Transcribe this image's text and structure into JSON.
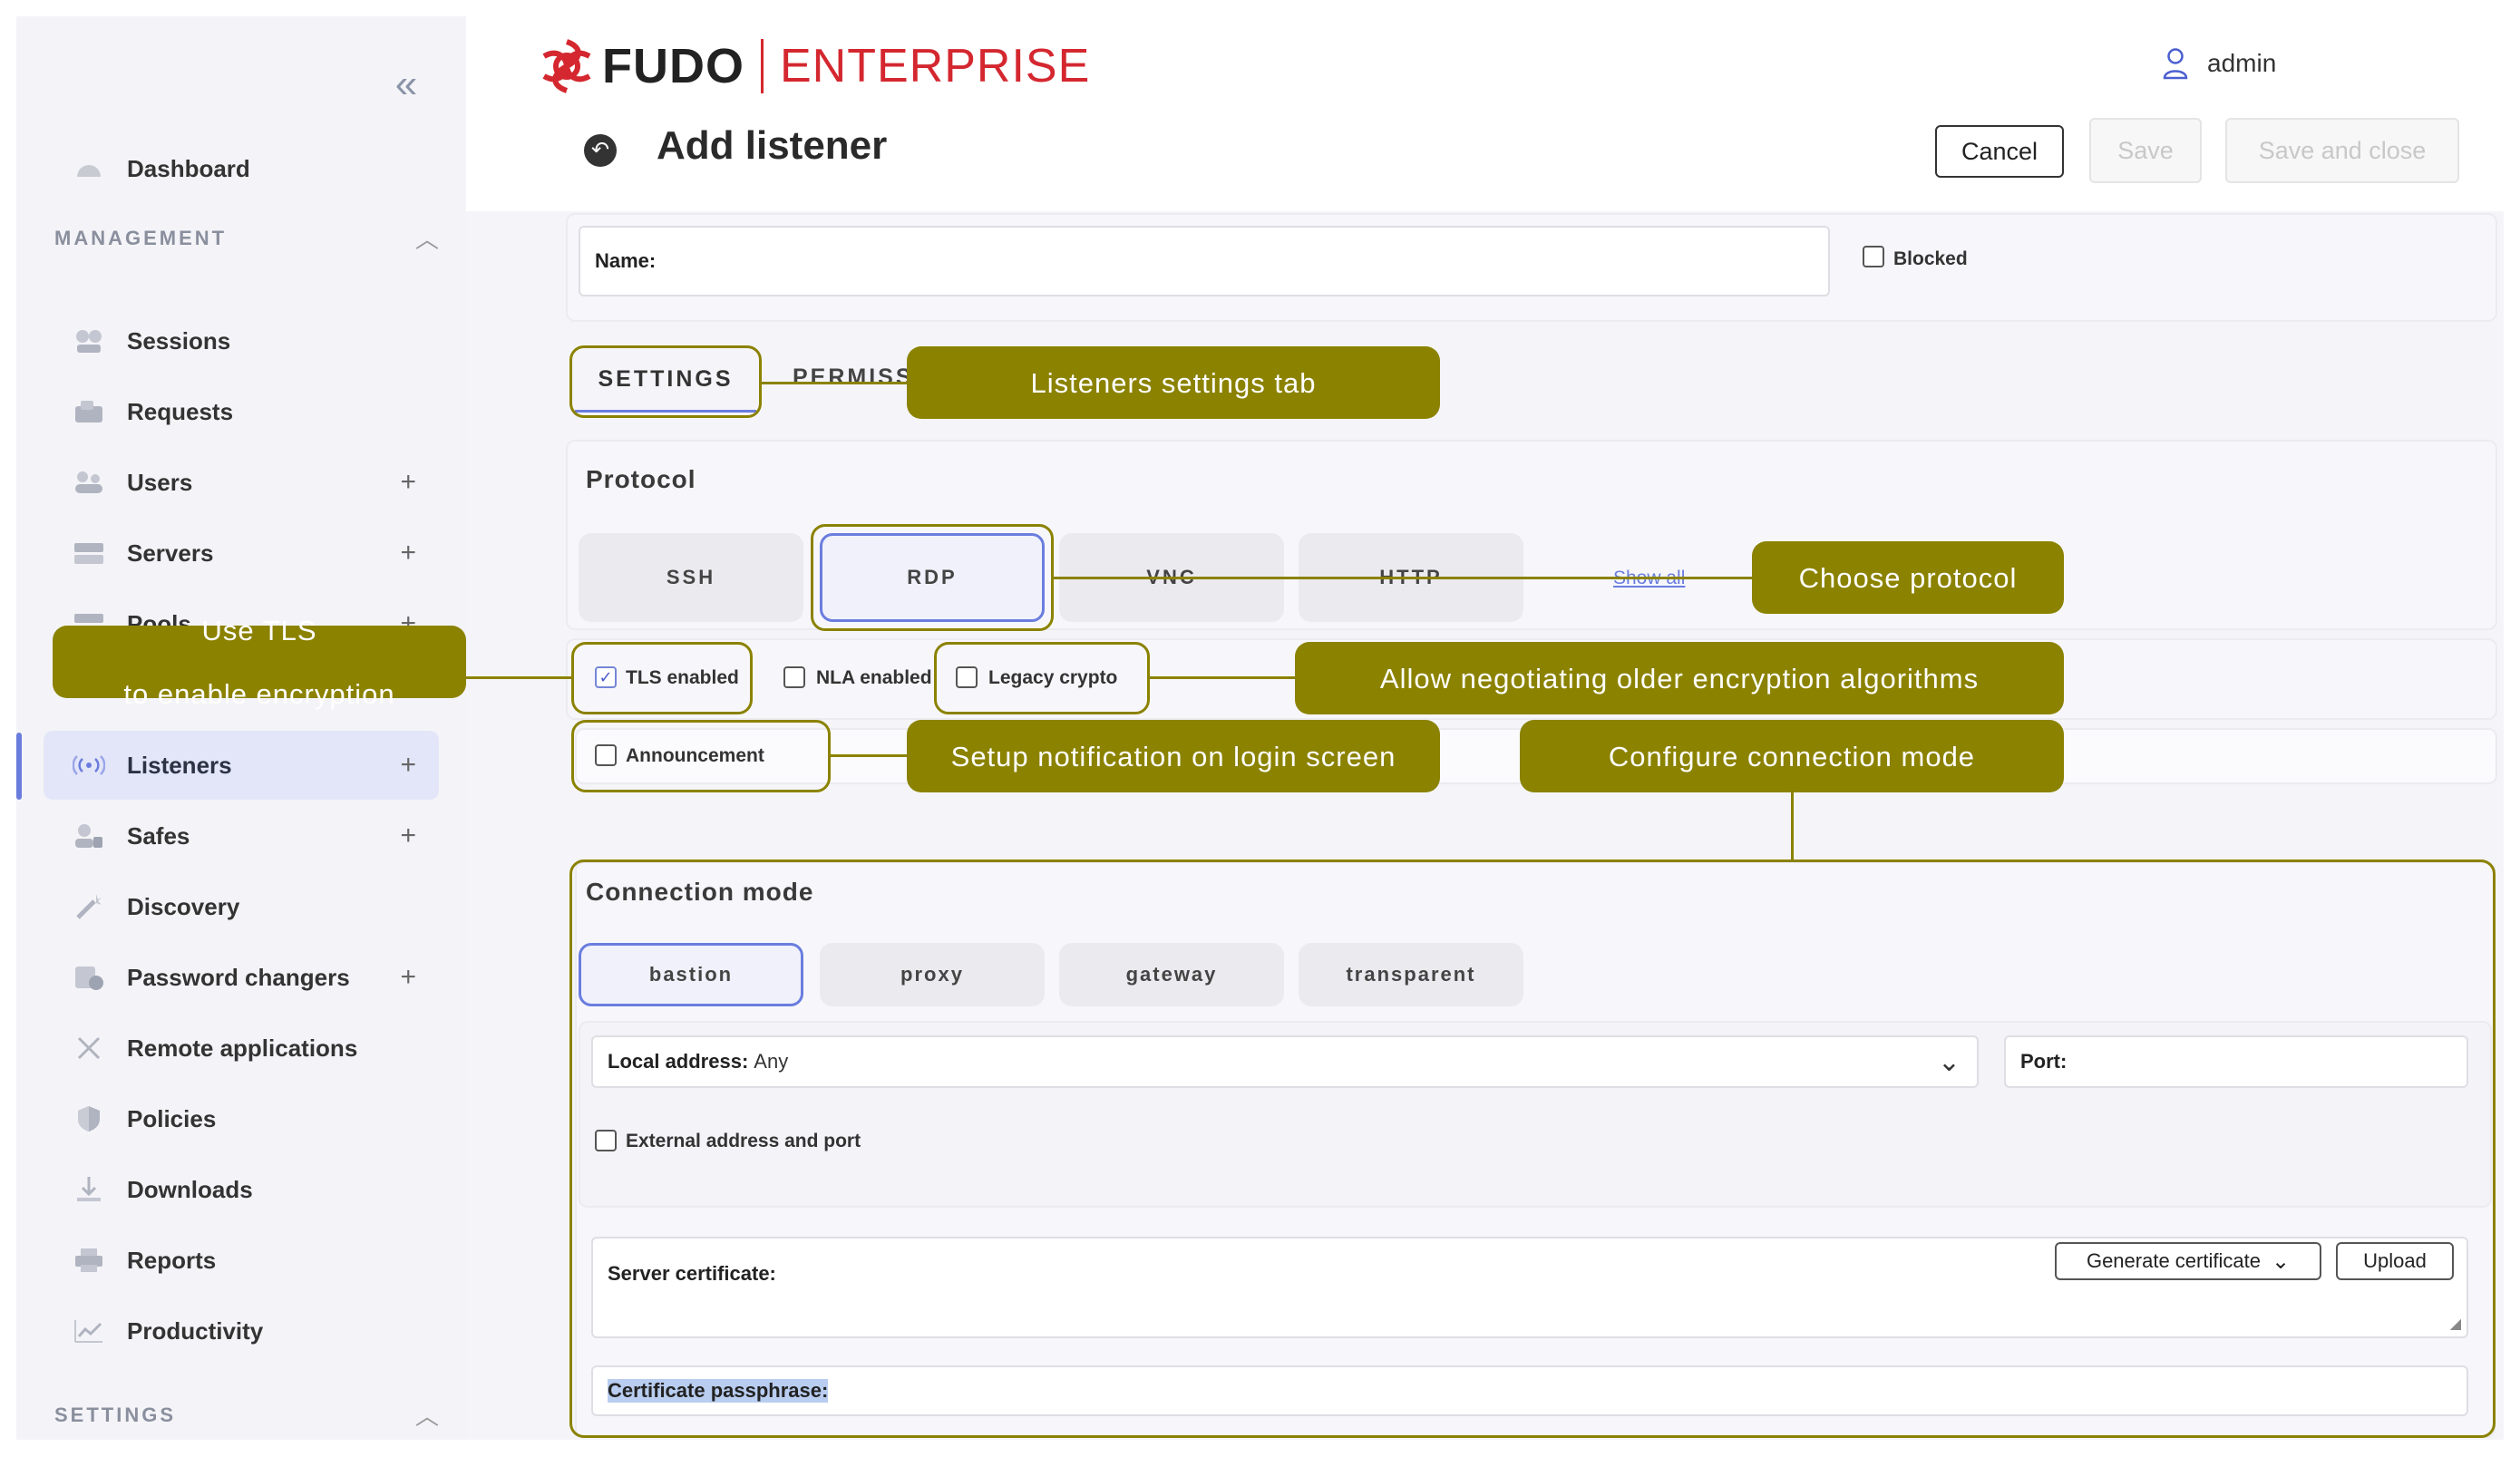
{
  "sidebar": {
    "dashboard": "Dashboard",
    "management_section": "MANAGEMENT",
    "settings_section": "SETTINGS",
    "items": [
      {
        "label": "Sessions",
        "icon": "sessions-icon"
      },
      {
        "label": "Requests",
        "icon": "requests-icon"
      },
      {
        "label": "Users",
        "icon": "users-icon",
        "plus": "+"
      },
      {
        "label": "Servers",
        "icon": "servers-icon",
        "plus": "+"
      },
      {
        "label": "Pools",
        "icon": "pools-icon",
        "plus": "+"
      },
      {
        "label": "Listeners",
        "icon": "listeners-icon",
        "plus": "+",
        "active": true
      },
      {
        "label": "Safes",
        "icon": "safes-icon",
        "plus": "+"
      },
      {
        "label": "Discovery",
        "icon": "discovery-icon"
      },
      {
        "label": "Password changers",
        "icon": "password-changers-icon",
        "plus": "+"
      },
      {
        "label": "Remote applications",
        "icon": "remote-applications-icon"
      },
      {
        "label": "Policies",
        "icon": "policies-icon"
      },
      {
        "label": "Downloads",
        "icon": "downloads-icon"
      },
      {
        "label": "Reports",
        "icon": "reports-icon"
      },
      {
        "label": "Productivity",
        "icon": "productivity-icon"
      }
    ]
  },
  "header": {
    "logo_fudo": "FUDO",
    "logo_enterprise": "ENTERPRISE",
    "user": "admin",
    "title": "Add listener",
    "cancel": "Cancel",
    "save": "Save",
    "save_close": "Save and close"
  },
  "form": {
    "name_label": "Name:",
    "name_value": "",
    "blocked": "Blocked",
    "tab_settings": "SETTINGS",
    "tab_permissions": "PERMISSI",
    "protocol_title": "Protocol",
    "protocols": [
      "SSH",
      "RDP",
      "VNC",
      "HTTP"
    ],
    "selected_protocol": "RDP",
    "show_all": "Show all",
    "tls": "TLS enabled",
    "nla": "NLA enabled",
    "legacy": "Legacy crypto",
    "announcement": "Announcement",
    "connection_mode_title": "Connection mode",
    "modes": [
      "bastion",
      "proxy",
      "gateway",
      "transparent"
    ],
    "selected_mode": "bastion",
    "local_address_label": "Local address:",
    "local_address_value": "Any",
    "port_label": "Port:",
    "external": "External address and port",
    "server_cert_label": "Server certificate:",
    "generate_cert": "Generate certificate",
    "upload": "Upload",
    "passphrase_label": "Certificate passphrase:"
  },
  "callouts": {
    "settings_tab": "Listeners settings tab",
    "protocol": "Choose protocol",
    "tls_line1": "Use TLS",
    "tls_line2": "to enable encryption",
    "legacy": "Allow negotiating older encryption algorithms",
    "announcement": "Setup notification on login screen",
    "connection_mode": "Configure connection mode"
  },
  "colors": {
    "accent": "#8b8200",
    "brand": "#d4272f",
    "active": "#6a7dde"
  }
}
